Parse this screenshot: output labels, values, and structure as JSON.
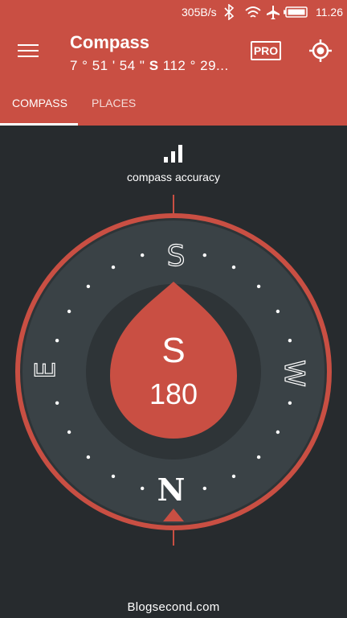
{
  "status": {
    "network_speed": "305B/s",
    "time": "11.26"
  },
  "header": {
    "title": "Compass",
    "coord_lat": "7 ° 51 ' 54 \" ",
    "coord_dir": "S",
    "coord_lon": " 112 ° 29...",
    "pro_label": "PRO"
  },
  "tabs": [
    {
      "label": "COMPASS",
      "active": true
    },
    {
      "label": "PLACES",
      "active": false
    }
  ],
  "accuracy": {
    "label": "compass accuracy"
  },
  "compass": {
    "heading_letter": "S",
    "heading_degrees": "180",
    "cardinals": {
      "top": "S",
      "bottom": "N",
      "left": "E",
      "right": "W"
    }
  },
  "footer": {
    "watermark": "Blogsecond.com"
  },
  "colors": {
    "accent": "#c94f43",
    "background": "#272b2e",
    "dial_ring": "#3a4246",
    "dial_inner": "#2e3437"
  },
  "icons": [
    "bluetooth-icon",
    "wifi-icon",
    "airplane-icon",
    "battery-icon",
    "menu-icon",
    "locate-icon",
    "signal-bars-icon"
  ]
}
